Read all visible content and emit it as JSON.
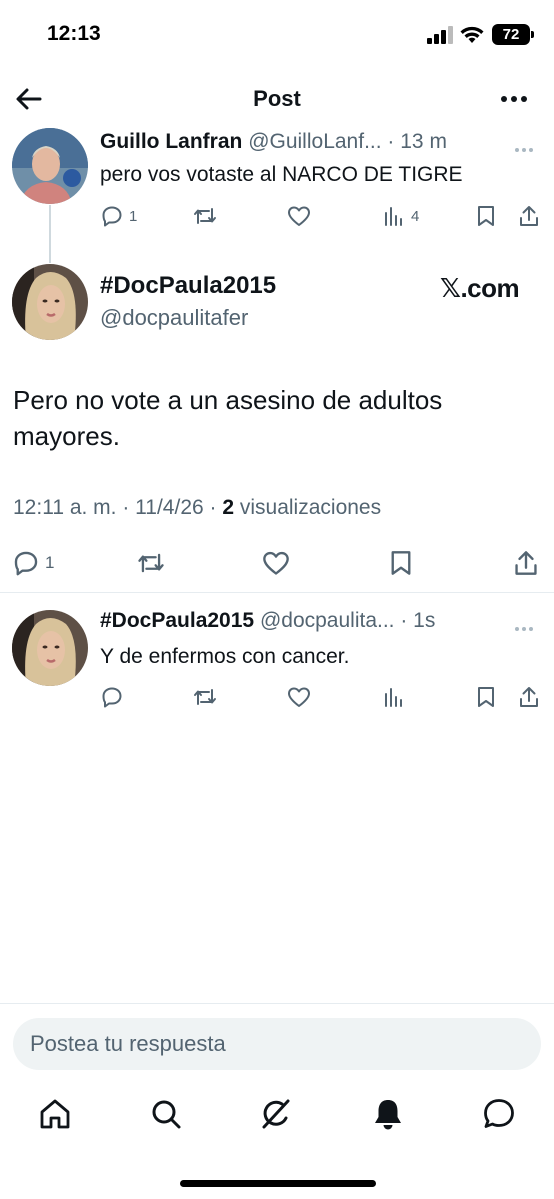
{
  "status_bar": {
    "time": "12:13",
    "battery": "72"
  },
  "header": {
    "title": "Post"
  },
  "reply_tweet": {
    "name": "Guillo Lanfran",
    "handle": "@GuilloLanf...",
    "time": "· 13 m",
    "text": "pero vos votaste al NARCO DE TIGRE",
    "replies": "1",
    "views": "4"
  },
  "main_tweet": {
    "name": "#DocPaula2015",
    "handle": "@docpaulitafer",
    "badge": "𝕏.com",
    "badge_x": "𝕏",
    "badge_rest": ".com",
    "text": "Pero no vote a un asesino de adultos mayores.",
    "timestamp": "12:11 a. m. · 11/4/26 · ",
    "views_count": "2",
    "views_label": " visualizaciones",
    "replies": "1"
  },
  "second_reply": {
    "name": "#DocPaula2015",
    "handle": "@docpaulita...",
    "time": "· 1s",
    "text": "Y de enfermos con cancer."
  },
  "composer": {
    "placeholder": "Postea tu respuesta"
  },
  "colors": {
    "text": "#0f1419",
    "secondary": "#536471",
    "divider": "#e6ecf0",
    "input_bg": "#eff3f4"
  },
  "icons": [
    "back-arrow-icon",
    "more-icon",
    "reply-icon",
    "retweet-icon",
    "like-icon",
    "views-icon",
    "bookmark-icon",
    "share-icon",
    "home-icon",
    "search-icon",
    "grok-icon",
    "notifications-icon",
    "messages-icon"
  ]
}
